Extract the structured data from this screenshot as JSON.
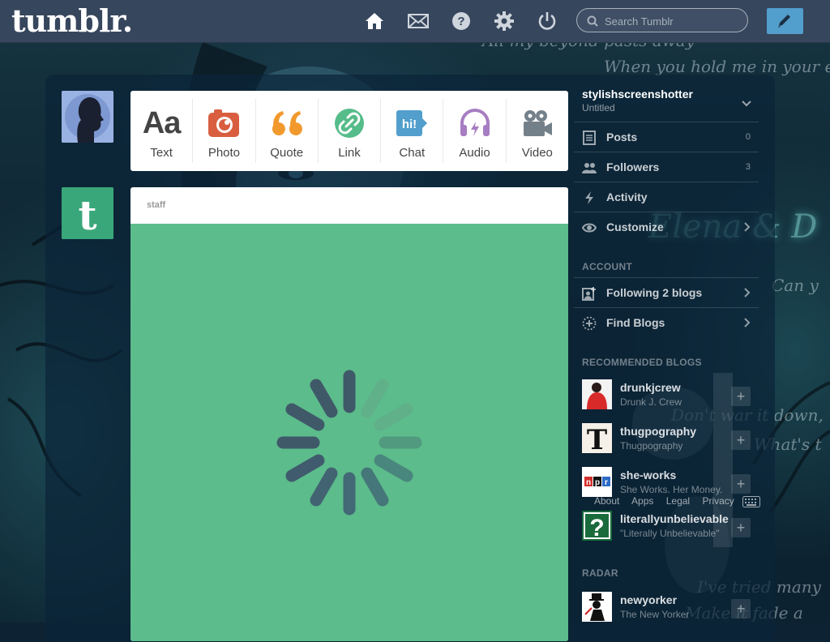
{
  "header": {
    "logo": "tumblr.",
    "search_placeholder": "Search Tumblr",
    "nav": [
      "home-icon",
      "mail-icon",
      "help-icon",
      "settings-icon",
      "power-icon"
    ]
  },
  "background_text": {
    "line1": "All my beyond pasts away",
    "line2": "When you hold me in your e",
    "line3": "Elena & D",
    "line4": "Can y",
    "line5": "Don't war it down,",
    "line6": "What's t",
    "line7": "I've tried many",
    "line8": "Make it fade a"
  },
  "post_types": [
    {
      "label": "Text",
      "icon": "text-icon",
      "color": "#444444"
    },
    {
      "label": "Photo",
      "icon": "photo-icon",
      "color": "#d95e40"
    },
    {
      "label": "Quote",
      "icon": "quote-icon",
      "color": "#f2992e"
    },
    {
      "label": "Link",
      "icon": "link-icon",
      "color": "#56bc8a"
    },
    {
      "label": "Chat",
      "icon": "chat-icon",
      "color": "#529ecc"
    },
    {
      "label": "Audio",
      "icon": "audio-icon",
      "color": "#a77dc2"
    },
    {
      "label": "Video",
      "icon": "video-icon",
      "color": "#748089"
    }
  ],
  "post": {
    "author": "staff",
    "body_color": "#5cbc8b"
  },
  "sidebar": {
    "blog_name": "stylishscreenshotter",
    "blog_title": "Untitled",
    "items": [
      {
        "label": "Posts",
        "count": "0"
      },
      {
        "label": "Followers",
        "count": "3"
      },
      {
        "label": "Activity"
      },
      {
        "label": "Customize"
      }
    ],
    "account_title": "ACCOUNT",
    "account_items": [
      {
        "label": "Following 2 blogs"
      },
      {
        "label": "Find Blogs"
      }
    ],
    "recommended_title": "RECOMMENDED BLOGS",
    "recommended": [
      {
        "name": "drunkjcrew",
        "subtitle": "Drunk J. Crew"
      },
      {
        "name": "thugpography",
        "subtitle": "Thugpography"
      },
      {
        "name": "she-works",
        "subtitle": "She Works. Her Money."
      },
      {
        "name": "literallyunbelievable",
        "subtitle": "\"Literally Unbelievable\""
      }
    ],
    "footer_links": [
      "About",
      "Apps",
      "Legal",
      "Privacy"
    ],
    "radar_title": "RADAR",
    "radar": {
      "name": "newyorker",
      "subtitle": "The New Yorker"
    }
  }
}
